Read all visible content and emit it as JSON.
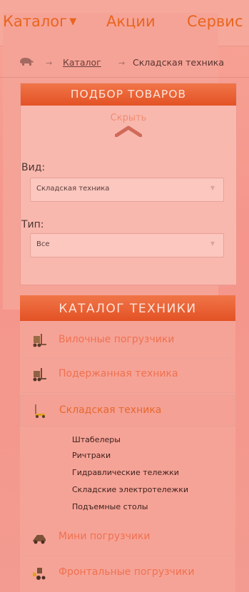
{
  "nav": {
    "catalog": "Каталог",
    "catalog_caret": "▼",
    "sales": "Акции",
    "service": "Сервис"
  },
  "breadcrumb": {
    "separator": "→",
    "link": "Каталог",
    "current": "Складская техника"
  },
  "filter": {
    "title": "ПОДБОР ТОВАРОВ",
    "hide_label": "Скрыть",
    "type_label": "Вид:",
    "type_value": "Складская техника",
    "kind_label": "Тип:",
    "kind_value": "Все"
  },
  "catalog": {
    "title": "КАТАЛОГ ТЕХНИКИ",
    "items": [
      {
        "label": "Вилочные погрузчики",
        "icon": "forklift-icon"
      },
      {
        "label": "Подержанная техника",
        "icon": "used-forklift-icon"
      },
      {
        "label": "Складская техника",
        "icon": "pallet-jack-icon"
      },
      {
        "label": "Мини погрузчики",
        "icon": "mini-loader-icon"
      },
      {
        "label": "Фронтальные погрузчики",
        "icon": "front-loader-icon"
      }
    ],
    "subitems": [
      "Штабелеры",
      "Ричтраки",
      "Гидравлические тележки",
      "Складские электротележки",
      "Подъемные столы"
    ]
  },
  "colors": {
    "accent": "#e8651f",
    "header_bg": "#e35225",
    "overlay": "#f5958b"
  }
}
